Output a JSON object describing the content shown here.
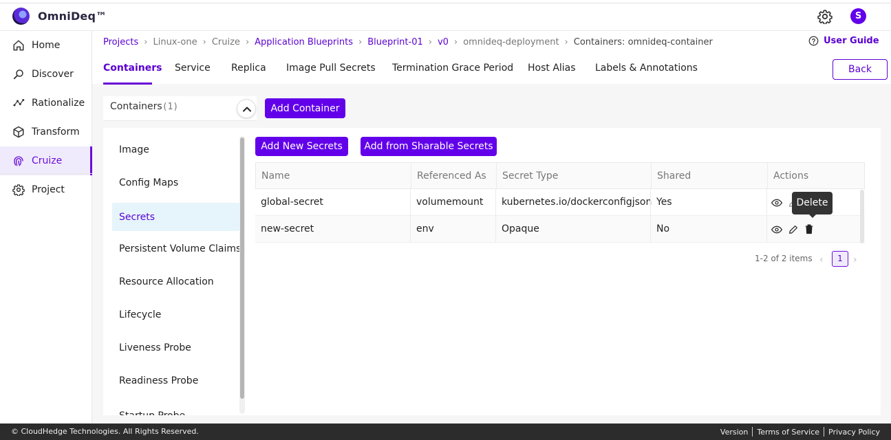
{
  "app": {
    "name": "OmniDeq™",
    "avatar_letter": "S"
  },
  "sidebar": {
    "items": [
      {
        "label": "Home",
        "icon": "home-icon"
      },
      {
        "label": "Discover",
        "icon": "discover-icon"
      },
      {
        "label": "Rationalize",
        "icon": "rationalize-icon"
      },
      {
        "label": "Transform",
        "icon": "cube-icon"
      },
      {
        "label": "Cruize",
        "icon": "fingerprint-icon",
        "active": true
      },
      {
        "label": "Project",
        "icon": "gear-icon"
      }
    ]
  },
  "breadcrumb": {
    "items": [
      {
        "label": "Projects",
        "link": true
      },
      {
        "label": "Linux-one",
        "link": false
      },
      {
        "label": "Cruize",
        "link": false
      },
      {
        "label": "Application Blueprints",
        "link": true
      },
      {
        "label": "Blueprint-01",
        "link": true
      },
      {
        "label": "v0",
        "link": true
      },
      {
        "label": "omnideq-deployment",
        "link": false
      },
      {
        "label": "Containers: omnideq-container",
        "link": false
      }
    ],
    "user_guide": "User Guide"
  },
  "tabs": {
    "items": [
      "Containers",
      "Service",
      "Replica",
      "Image Pull Secrets",
      "Termination Grace Period",
      "Host Alias",
      "Labels & Annotations"
    ],
    "back_label": "Back"
  },
  "containers": {
    "label": "Containers",
    "count": "(1)",
    "add_label": "Add Container"
  },
  "menu": {
    "items": [
      "Image",
      "Config Maps",
      "Secrets",
      "Persistent Volume Claims",
      "Resource Allocation",
      "Lifecycle",
      "Liveness Probe",
      "Readiness Probe",
      "Startup Probe"
    ],
    "active": "Secrets"
  },
  "secrets": {
    "add_new_label": "Add New Secrets",
    "add_sharable_label": "Add from Sharable Secrets",
    "columns": [
      "Name",
      "Referenced As",
      "Secret Type",
      "Shared",
      "Actions"
    ],
    "rows": [
      {
        "name": "global-secret",
        "referenced_as": "volumemount",
        "secret_type": "kubernetes.io/dockerconfigjson",
        "shared": "Yes"
      },
      {
        "name": "new-secret",
        "referenced_as": "env",
        "secret_type": "Opaque",
        "shared": "No"
      }
    ],
    "tooltip": "Delete",
    "pagination": {
      "summary": "1-2 of 2 items",
      "current_page": "1"
    }
  },
  "footer": {
    "copyright": "© CloudHedge Technologies. All Rights Reserved.",
    "links": [
      "Version",
      "Terms of Service",
      "Privacy Policy"
    ]
  },
  "colors": {
    "accent": "#6200ea",
    "link": "#5a00d1",
    "footer_bg": "#2c2c2c"
  }
}
